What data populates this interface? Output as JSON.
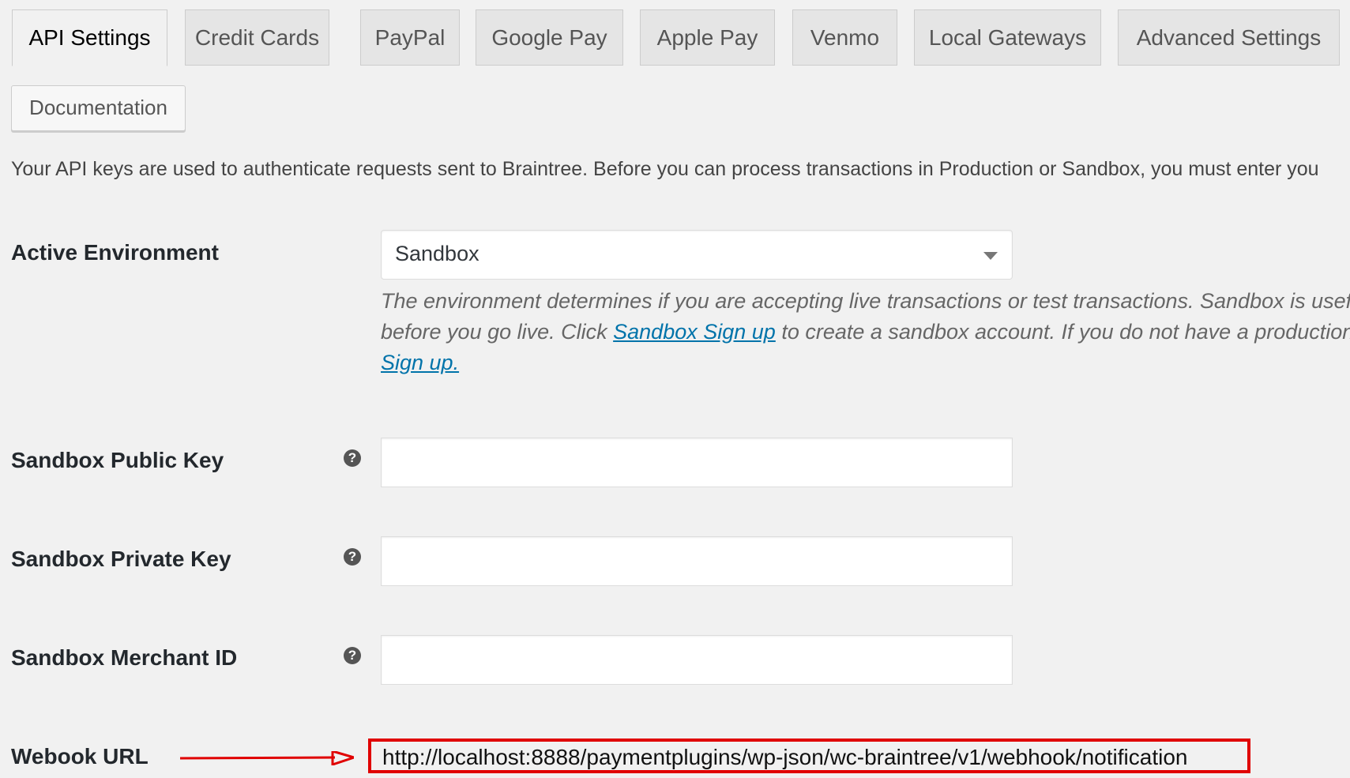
{
  "tabs": [
    {
      "label": "API Settings",
      "active": true
    },
    {
      "label": "Credit Cards"
    },
    {
      "label": "PayPal"
    },
    {
      "label": "Google Pay"
    },
    {
      "label": "Apple Pay"
    },
    {
      "label": "Venmo"
    },
    {
      "label": "Local Gateways"
    },
    {
      "label": "Advanced Settings"
    }
  ],
  "documentation_label": "Documentation",
  "intro_text": "Your API keys are used to authenticate requests sent to Braintree. Before you can process transactions in Production or Sandbox, you must enter you",
  "active_environment": {
    "label": "Active Environment",
    "value": "Sandbox",
    "desc_line1": "The environment determines if you are accepting live transactions or test transactions. Sandbox is usef",
    "desc_line2_before": "before you go live. Click ",
    "desc_link1": "Sandbox Sign up",
    "desc_line2_after": " to create a sandbox account. If you do not have a production",
    "desc_link2": "Sign up."
  },
  "fields": {
    "public_key_label": "Sandbox Public Key",
    "private_key_label": "Sandbox Private Key",
    "merchant_id_label": "Sandbox Merchant ID",
    "help_glyph": "?"
  },
  "webhook": {
    "label": "Webook URL",
    "url": "http://localhost:8888/paymentplugins/wp-json/wc-braintree/v1/webhook/notification",
    "highlight_color": "#e00000"
  },
  "colors": {
    "link": "#0073aa",
    "background": "#f1f1f1"
  }
}
